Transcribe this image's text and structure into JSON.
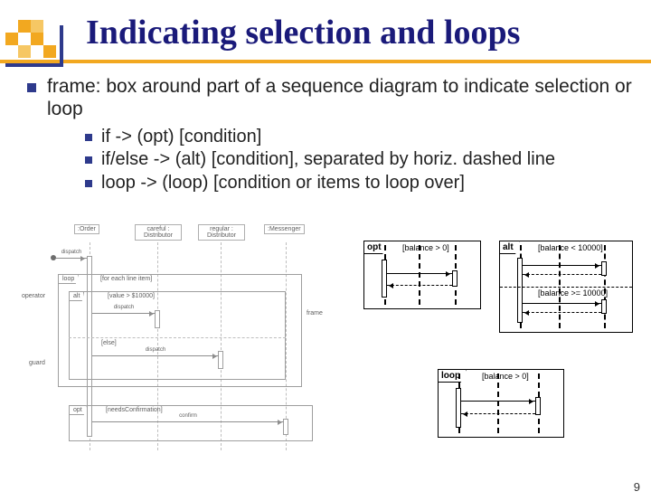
{
  "title": "Indicating selection and loops",
  "main_bullet": "frame: box around part of a sequence diagram to indicate selection or loop",
  "sub_bullets": [
    "if -> (opt) [condition]",
    "if/else -> (alt) [condition], separated by horiz. dashed line",
    "loop -> (loop) [condition or items to loop over]"
  ],
  "large_diagram": {
    "participants": [
      ":Order",
      "careful : Distributor",
      "regular : Distributor",
      ":Messenger"
    ],
    "labels": {
      "dispatch_msg": "dispatch",
      "loop_tag": "loop",
      "loop_cond": "[for each line item]",
      "alt_tag": "alt",
      "alt_cond": "[value > $10000]",
      "else_label": "[else]",
      "dispatch2": "dispatch",
      "dispatch3": "dispatch",
      "opt_tag": "opt",
      "opt_cond": "[needsConfirmation]",
      "confirm": "confirm",
      "operator_note": "operator",
      "guard_note": "guard",
      "frame_note": "frame"
    }
  },
  "mini_opt": {
    "tag": "opt",
    "cond": "[balance > 0]"
  },
  "mini_alt": {
    "tag": "alt",
    "cond1": "[balance < 10000]",
    "cond2": "[balance >= 10000]"
  },
  "mini_loop": {
    "tag": "loop",
    "cond": "[balance > 0]"
  },
  "page_number": "9"
}
